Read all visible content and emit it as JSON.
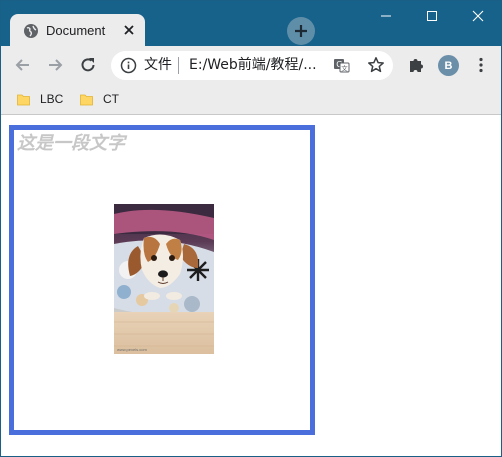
{
  "browser": {
    "tab": {
      "title": "Document",
      "close_glyph": "✕",
      "favicon": "globe-icon"
    },
    "new_tab_glyph": "+",
    "window_controls": {
      "minimize": "minimize-icon",
      "maximize": "maximize-icon",
      "close": "close-icon"
    }
  },
  "toolbar": {
    "back": "back-arrow-icon",
    "forward": "forward-arrow-icon",
    "reload": "reload-icon",
    "address": {
      "security_label": "文件",
      "url": "E:/Web前端/教程/..."
    },
    "extensions": "puzzle-icon",
    "profile_initial": "B",
    "menu": "more-vertical-icon"
  },
  "bookmarks": [
    {
      "label": "LBC"
    },
    {
      "label": "CT"
    }
  ],
  "page": {
    "text": "这是一段文字",
    "image_caption": "www.pexels.com",
    "colors": {
      "border": "#4a6fdc",
      "text": "#c7c7c7"
    }
  }
}
